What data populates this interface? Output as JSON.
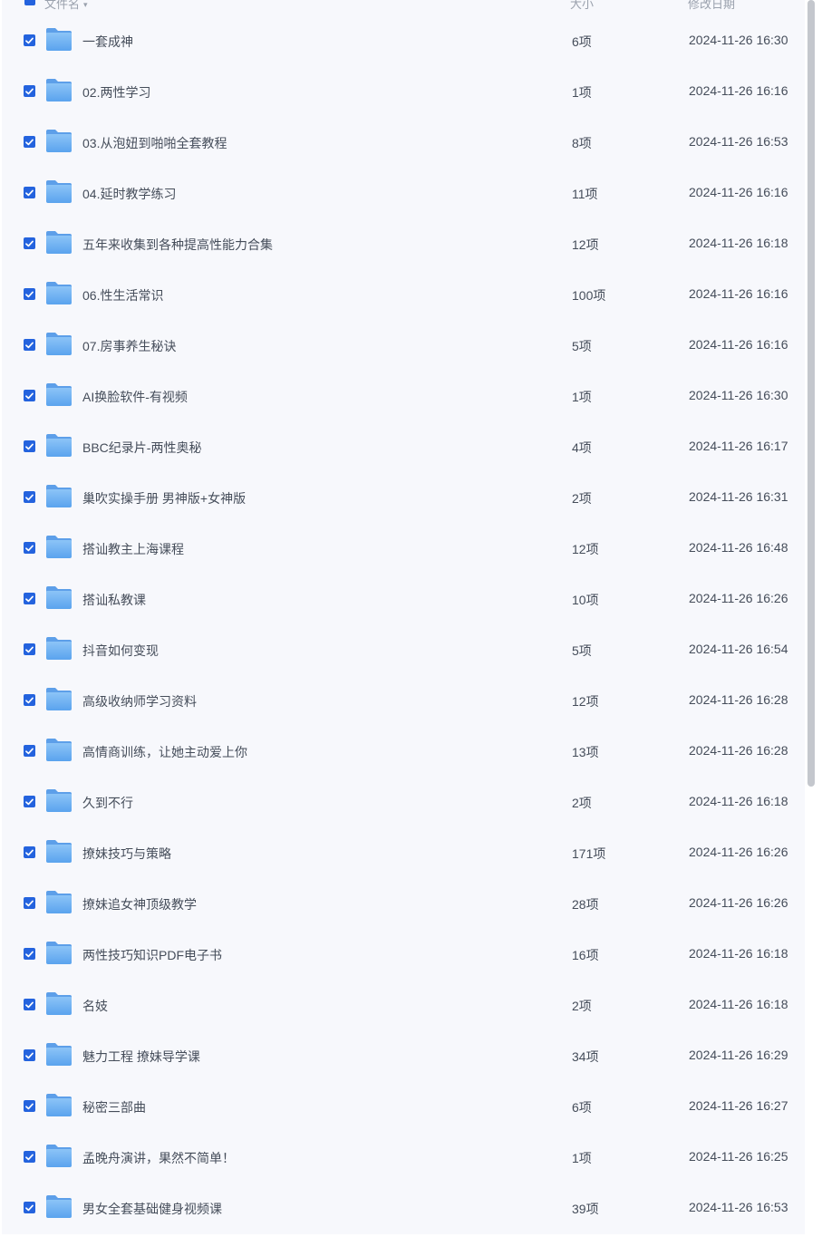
{
  "header": {
    "name_label": "文件名",
    "size_label": "大小",
    "date_label": "修改日期"
  },
  "colors": {
    "checkbox": "#2463de",
    "folder": "#6fb0f2",
    "row_background": "#f7f8fc",
    "text": "#454d5a"
  },
  "files": [
    {
      "name": "一套成神",
      "size": "6项",
      "date": "2024-11-26 16:30"
    },
    {
      "name": "02.两性学习",
      "size": "1项",
      "date": "2024-11-26 16:16"
    },
    {
      "name": "03.从泡妞到啪啪全套教程",
      "size": "8项",
      "date": "2024-11-26 16:53"
    },
    {
      "name": "04.延时教学练习",
      "size": "11项",
      "date": "2024-11-26 16:16"
    },
    {
      "name": "五年来收集到各种提高性能力合集",
      "size": "12项",
      "date": "2024-11-26 16:18"
    },
    {
      "name": "06.性生活常识",
      "size": "100项",
      "date": "2024-11-26 16:16"
    },
    {
      "name": "07.房事养生秘诀",
      "size": "5项",
      "date": "2024-11-26 16:16"
    },
    {
      "name": "AI换脸软件-有视频",
      "size": "1项",
      "date": "2024-11-26 16:30"
    },
    {
      "name": "BBC纪录片-两性奥秘",
      "size": "4项",
      "date": "2024-11-26 16:17"
    },
    {
      "name": "巢吹实操手册 男神版+女神版",
      "size": "2项",
      "date": "2024-11-26 16:31"
    },
    {
      "name": "搭讪教主上海课程",
      "size": "12项",
      "date": "2024-11-26 16:48"
    },
    {
      "name": "搭讪私教课",
      "size": "10项",
      "date": "2024-11-26 16:26"
    },
    {
      "name": "抖音如何变现",
      "size": "5项",
      "date": "2024-11-26 16:54"
    },
    {
      "name": "高级收纳师学习资料",
      "size": "12项",
      "date": "2024-11-26 16:28"
    },
    {
      "name": "高情商训练，让她主动爱上你",
      "size": "13项",
      "date": "2024-11-26 16:28"
    },
    {
      "name": "久到不行",
      "size": "2项",
      "date": "2024-11-26 16:18"
    },
    {
      "name": "撩妹技巧与策略",
      "size": "171项",
      "date": "2024-11-26 16:26"
    },
    {
      "name": "撩妹追女神顶级教学",
      "size": "28项",
      "date": "2024-11-26 16:26"
    },
    {
      "name": "两性技巧知识PDF电子书",
      "size": "16项",
      "date": "2024-11-26 16:18"
    },
    {
      "name": "名妓",
      "size": "2项",
      "date": "2024-11-26 16:18"
    },
    {
      "name": "魅力工程 撩妹导学课",
      "size": "34项",
      "date": "2024-11-26 16:29"
    },
    {
      "name": "秘密三部曲",
      "size": "6项",
      "date": "2024-11-26 16:27"
    },
    {
      "name": "孟晚舟演讲，果然不简单！",
      "size": "1项",
      "date": "2024-11-26 16:25"
    },
    {
      "name": "男女全套基础健身视频课",
      "size": "39项",
      "date": "2024-11-26 16:53"
    }
  ]
}
